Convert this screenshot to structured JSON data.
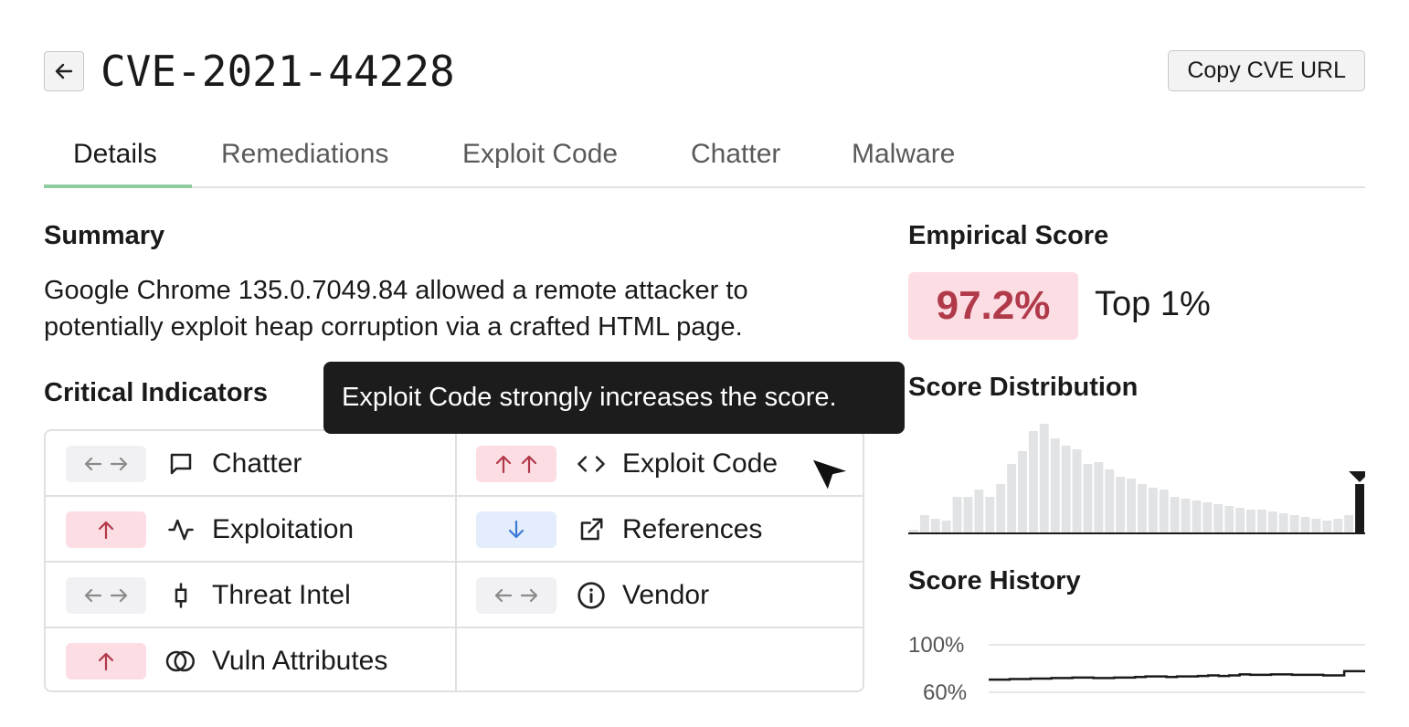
{
  "header": {
    "title": "CVE-2021-44228",
    "copy_label": "Copy CVE URL"
  },
  "tabs": [
    {
      "label": "Details"
    },
    {
      "label": "Remediations"
    },
    {
      "label": "Exploit Code"
    },
    {
      "label": "Chatter"
    },
    {
      "label": "Malware"
    }
  ],
  "summary": {
    "title": "Summary",
    "text": "Google Chrome 135.0.7049.84 allowed a remote attacker to potentially exploit heap corruption via a crafted HTML page."
  },
  "indicators": {
    "title": "Critical Indicators",
    "items": [
      {
        "label": "Chatter",
        "effect": "neutral",
        "icon": "chat-icon"
      },
      {
        "label": "Exploit Code",
        "effect": "strong-up",
        "icon": "code-icon"
      },
      {
        "label": "Exploitation",
        "effect": "up",
        "icon": "activity-icon"
      },
      {
        "label": "References",
        "effect": "down",
        "icon": "external-link-icon"
      },
      {
        "label": "Threat Intel",
        "effect": "neutral",
        "icon": "candlestick-icon"
      },
      {
        "label": "Vendor",
        "effect": "neutral",
        "icon": "info-icon"
      },
      {
        "label": "Vuln Attributes",
        "effect": "up",
        "icon": "overlap-circles-icon"
      }
    ]
  },
  "tooltip": {
    "text": "Exploit Code strongly increases the score."
  },
  "empirical": {
    "title": "Empirical Score",
    "score": "97.2%",
    "rank": "Top 1%"
  },
  "distribution": {
    "title": "Score Distribution",
    "chart_data": {
      "type": "bar",
      "bar_heights": [
        4,
        20,
        16,
        14,
        40,
        40,
        48,
        40,
        54,
        76,
        90,
        112,
        120,
        104,
        96,
        92,
        76,
        78,
        70,
        62,
        60,
        54,
        50,
        48,
        40,
        38,
        36,
        34,
        32,
        30,
        28,
        26,
        26,
        24,
        22,
        20,
        18,
        16,
        14,
        16,
        20,
        54
      ],
      "highlighted_index": 41,
      "color": "#e2e3e5",
      "highlight_color": "#1a1a1a"
    }
  },
  "history": {
    "title": "Score History",
    "chart_data": {
      "type": "line",
      "y_ticks": [
        "100%",
        "60%"
      ],
      "ylim": [
        55,
        100
      ],
      "values": [
        67,
        67,
        67.5,
        67.5,
        68,
        68,
        68.5,
        68.5,
        69,
        69,
        68.5,
        68.5,
        69,
        69,
        69.5,
        70,
        70,
        69.5,
        70,
        70,
        70.5,
        71,
        70.5,
        71,
        72,
        71.5,
        71.5,
        72,
        72,
        71.5,
        71.5,
        71.5,
        71,
        71,
        75,
        75
      ]
    }
  }
}
